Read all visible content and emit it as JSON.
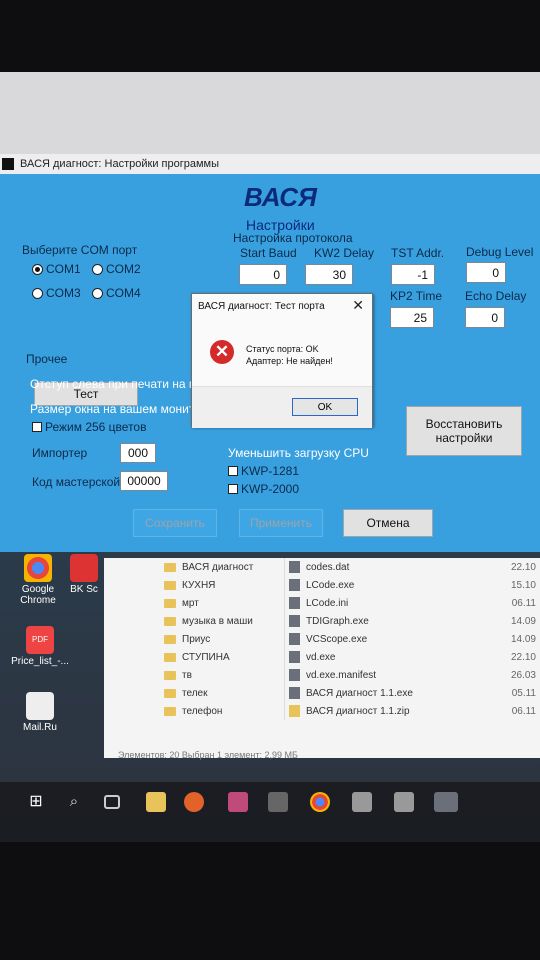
{
  "window": {
    "title": "ВАСЯ диагност: Настройки программы",
    "app_name": "ВАСЯ",
    "subtitle": "Настройки"
  },
  "com_port": {
    "label": "Выберите COM порт",
    "options": [
      "COM1",
      "COM2",
      "COM3",
      "COM4"
    ],
    "selected": "COM1",
    "test_button": "Тест"
  },
  "protocol": {
    "label": "Настройка протокола",
    "start_baud": {
      "label": "Start Baud",
      "value": "0"
    },
    "kw2_delay": {
      "label": "KW2 Delay",
      "value": "30"
    },
    "tst_addr": {
      "label": "TST Addr.",
      "value": "-1"
    },
    "debug_level": {
      "label": "Debug Level",
      "value": "0"
    },
    "kp2_time": {
      "label": "KP2 Time",
      "value": "25"
    },
    "echo_delay": {
      "label": "Echo Delay",
      "value": "0"
    }
  },
  "misc": {
    "label": "Прочее",
    "left_margin": "Отступ слева при печати на пр",
    "window_size": "Размер окна на вашем монито",
    "mode256": "Режим 256 цветов",
    "importer_label": "Импортер",
    "importer_value": "000",
    "master_code_label": "Код мастерской",
    "master_code_value": "00000",
    "reduce_cpu": "Уменьшить загрузку CPU",
    "kwp1281": "KWP-1281",
    "kwp2000": "KWP-2000",
    "restore_button": "Восстановить настройки"
  },
  "footer": {
    "save": "Сохранить",
    "apply": "Применить",
    "cancel": "Отмена"
  },
  "message_box": {
    "title": "ВАСЯ диагност: Тест порта",
    "close": "✕",
    "line1": "Статус порта: OK",
    "line2": "Адаптер:  Не найден!",
    "ok": "OK"
  },
  "desktop": {
    "icons": [
      "Google Chrome",
      "BK Sc",
      "Price_list_-...",
      "Mail.Ru"
    ]
  },
  "explorer": {
    "folders": [
      "ВАСЯ диагност",
      "КУХНЯ",
      "мрт",
      "музыка в маши",
      "Приус",
      "СТУПИНА",
      "тв",
      "телек",
      "телефон"
    ],
    "files": [
      {
        "name": "codes.dat",
        "date": "22.10"
      },
      {
        "name": "LCode.exe",
        "date": "15.10"
      },
      {
        "name": "LCode.ini",
        "date": "06.11"
      },
      {
        "name": "TDIGraph.exe",
        "date": "14.09"
      },
      {
        "name": "VCScope.exe",
        "date": "14.09"
      },
      {
        "name": "vd.exe",
        "date": "22.10"
      },
      {
        "name": "vd.exe.manifest",
        "date": "26.03"
      },
      {
        "name": "ВАСЯ диагност 1.1.exe",
        "date": "05.11"
      },
      {
        "name": "ВАСЯ диагност 1.1.zip",
        "date": "06.11"
      }
    ],
    "status": "Элементов: 20    Выбран 1 элемент: 2,99 МБ"
  },
  "colors": {
    "dialog_bg": "#39a0e0",
    "title_blue": "#0b2a7a",
    "error_red": "#d42a2a"
  }
}
